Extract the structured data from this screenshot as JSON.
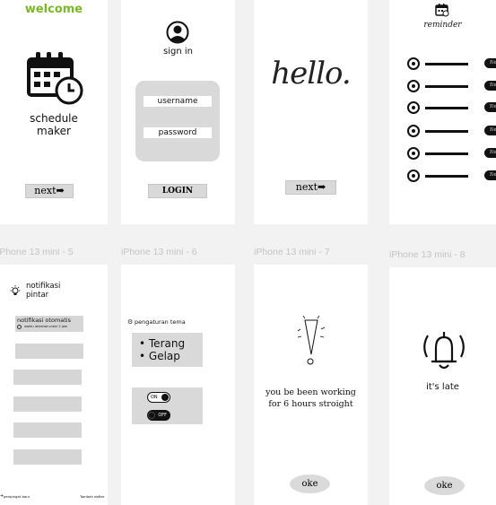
{
  "frame_labels": {
    "f5": "iPhone 13 mini - 5",
    "f6": "iPhone 13 mini - 6",
    "f7": "iPhone 13 mini - 7",
    "f8": "iPhone 13 mini - 8"
  },
  "welcome": {
    "title": "welcome",
    "app_name_line1": "schedule",
    "app_name_line2": "maker",
    "next_label": "next➡"
  },
  "signin": {
    "title": "sign in",
    "username_placeholder": "username",
    "password_placeholder": "password",
    "login_label": "LOGIN"
  },
  "hello": {
    "greeting": "hello.",
    "next_label": "next➡"
  },
  "reminder": {
    "title": "reminder",
    "items": [
      "Time",
      "Time",
      "Time",
      "Time",
      "Time",
      "Time"
    ]
  },
  "notif": {
    "title_line1": "notifikasi",
    "title_line2": "pintar",
    "auto_title": "notifikasi otomatis",
    "auto_sub": "waktu istirahat untuk 2 jam",
    "footer_left": "pengingat baru",
    "footer_right": "Tambah daftar"
  },
  "theme": {
    "title": "pengaturan tema",
    "option_light": "• Terang",
    "option_dark": "• Gelap",
    "toggle_on": "ON",
    "toggle_off": "OFF"
  },
  "warning": {
    "message_line1": "you be been working",
    "message_line2": "for 6 hours stroight",
    "ok_label": "oke"
  },
  "late": {
    "message": "it's late",
    "ok_label": "oke"
  },
  "colors": {
    "welcome_green": "#7ab828",
    "dark": "#111111",
    "panel_gray": "#d9d9d9"
  }
}
